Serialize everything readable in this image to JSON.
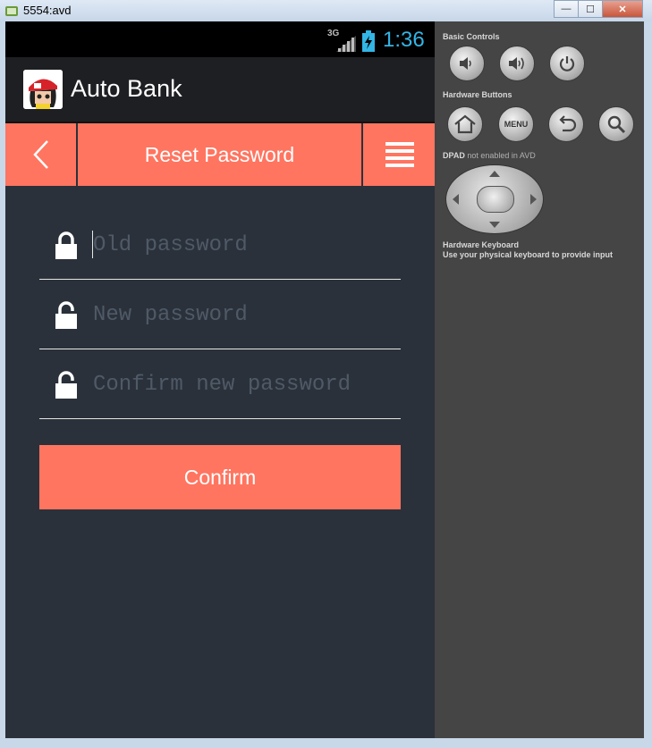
{
  "window": {
    "title": "5554:avd",
    "controls": {
      "minimize": "—",
      "maximize": "☐",
      "close": "✕"
    }
  },
  "status_bar": {
    "network": "3G",
    "time": "1:36"
  },
  "action_bar": {
    "title": "Auto Bank"
  },
  "header": {
    "title": "Reset Password",
    "back_icon": "chevron-left-icon",
    "menu_icon": "menu-icon"
  },
  "form": {
    "old_password": {
      "value": "",
      "placeholder": "Old password"
    },
    "new_password": {
      "value": "",
      "placeholder": "New password"
    },
    "confirm_password": {
      "value": "",
      "placeholder": "Confirm new password"
    },
    "confirm_label": "Confirm"
  },
  "emulator_panel": {
    "basic_controls_label": "Basic Controls",
    "hardware_buttons_label": "Hardware Buttons",
    "dpad_label": "DPAD",
    "dpad_note": "not enabled in AVD",
    "keyboard_title": "Hardware Keyboard",
    "keyboard_note": "Use your physical keyboard to provide input",
    "menu_button_label": "MENU"
  },
  "colors": {
    "accent": "#ff7560",
    "background": "#2b313a",
    "status_time": "#33b5e5",
    "panel": "#454545"
  }
}
